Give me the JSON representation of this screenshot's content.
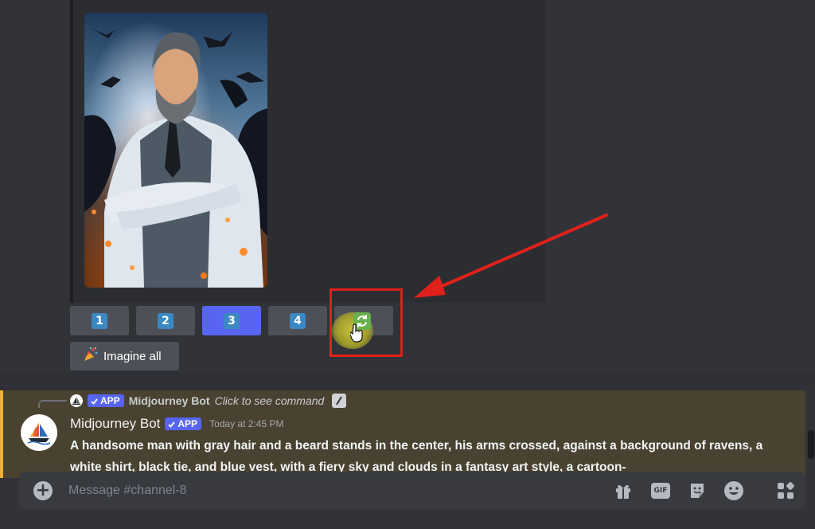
{
  "buttons": {
    "upscale": [
      {
        "label": "1",
        "active": false
      },
      {
        "label": "2",
        "active": false
      },
      {
        "label": "3",
        "active": true
      },
      {
        "label": "4",
        "active": false
      }
    ],
    "reroll_icon": "refresh-icon",
    "imagine_all": "Imagine all",
    "imagine_all_icon": "party-popper-icon"
  },
  "reply": {
    "badge": "APP",
    "name": "Midjourney Bot",
    "command": "Click to see command"
  },
  "message": {
    "author": "Midjourney Bot",
    "badge": "APP",
    "timestamp": "Today at 2:45 PM",
    "content": "A handsome man with gray hair and a beard stands in the center, his arms crossed, against a background of ravens, a white shirt, black tie, and blue vest, with a fiery sky and clouds in a fantasy art style, a cartoon-"
  },
  "composer": {
    "placeholder": "Message #channel-8",
    "gif_label": "GIF"
  },
  "colors": {
    "accent": "#5865f2",
    "highlight": "#e0201b",
    "mention_bar": "#f0b232"
  }
}
